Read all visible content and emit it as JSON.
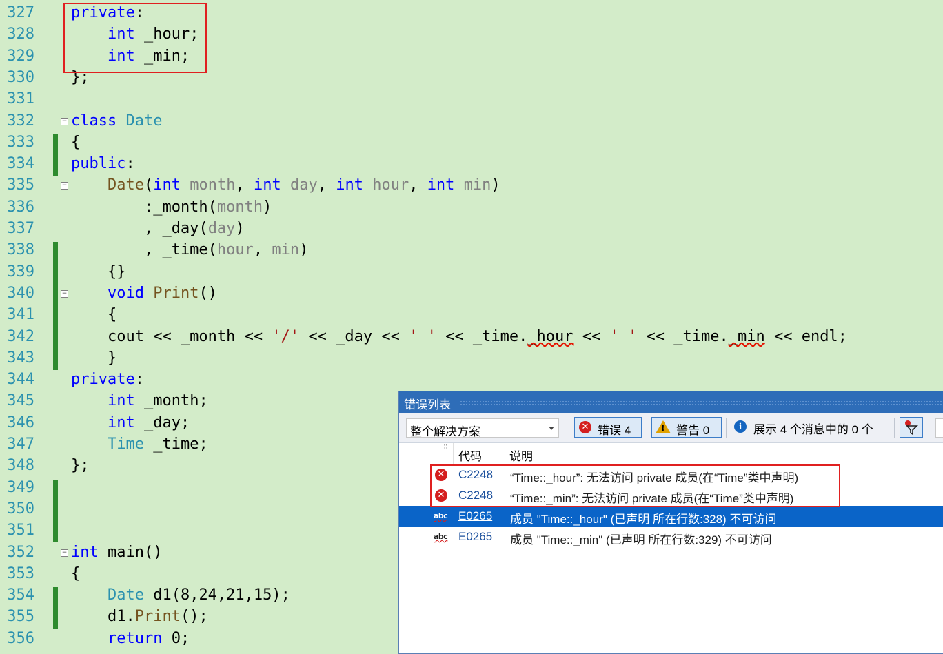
{
  "editor": {
    "lines": [
      {
        "n": "327",
        "t": "private:"
      },
      {
        "n": "328",
        "t": "    int _hour;"
      },
      {
        "n": "329",
        "t": "    int _min;"
      },
      {
        "n": "330",
        "t": "};"
      },
      {
        "n": "331",
        "t": ""
      },
      {
        "n": "332",
        "t": "class Date"
      },
      {
        "n": "333",
        "t": "{"
      },
      {
        "n": "334",
        "t": "public:"
      },
      {
        "n": "335",
        "t": "    Date(int month, int day, int hour, int min)"
      },
      {
        "n": "336",
        "t": "        :_month(month)"
      },
      {
        "n": "337",
        "t": "        , _day(day)"
      },
      {
        "n": "338",
        "t": "        , _time(hour, min)"
      },
      {
        "n": "339",
        "t": "    {}"
      },
      {
        "n": "340",
        "t": "    void Print()"
      },
      {
        "n": "341",
        "t": "    {"
      },
      {
        "n": "342",
        "t": "    cout << _month << '/' << _day << ' ' << _time._hour << ' ' << _time._min << endl;"
      },
      {
        "n": "343",
        "t": "    }"
      },
      {
        "n": "344",
        "t": "private:"
      },
      {
        "n": "345",
        "t": "    int _month;"
      },
      {
        "n": "346",
        "t": "    int _day;"
      },
      {
        "n": "347",
        "t": "    Time _time;"
      },
      {
        "n": "348",
        "t": "};"
      },
      {
        "n": "349",
        "t": ""
      },
      {
        "n": "350",
        "t": ""
      },
      {
        "n": "351",
        "t": ""
      },
      {
        "n": "352",
        "t": "int main()"
      },
      {
        "n": "353",
        "t": "{"
      },
      {
        "n": "354",
        "t": "    Date d1(8,24,21,15);"
      },
      {
        "n": "355",
        "t": "    d1.Print();"
      },
      {
        "n": "356",
        "t": "    return 0;"
      }
    ]
  },
  "error_list": {
    "title": "错误列表",
    "scope": "整个解决方案",
    "errors_label": "错误 4",
    "warnings_label": "警告 0",
    "messages_label": "展示 4 个消息中的 0 个",
    "col_code": "代码",
    "col_desc": "说明",
    "rows": [
      {
        "code": "C2248",
        "desc": "“Time::_hour”: 无法访问 private 成员(在“Time”类中声明)",
        "kind": "error"
      },
      {
        "code": "C2248",
        "desc": "“Time::_min”: 无法访问 private 成员(在“Time”类中声明)",
        "kind": "error"
      },
      {
        "code": "E0265",
        "desc": "成员 \"Time::_hour\" (已声明 所在行数:328) 不可访问",
        "kind": "intellisense"
      },
      {
        "code": "E0265",
        "desc": "成员 \"Time::_min\" (已声明 所在行数:329) 不可访问",
        "kind": "intellisense"
      }
    ]
  },
  "colors": {
    "editor_bg": "#d3ecc9",
    "keyword": "#0000ff",
    "type": "#2b91af",
    "param": "#808080",
    "selection": "#0a64c8",
    "highlight_box": "#e02020"
  }
}
